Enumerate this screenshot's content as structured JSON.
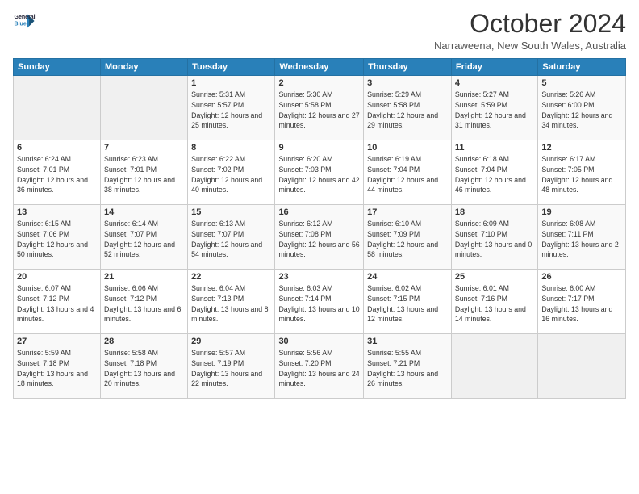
{
  "logo": {
    "line1": "General",
    "line2": "Blue"
  },
  "title": "October 2024",
  "location": "Narraweena, New South Wales, Australia",
  "days_header": [
    "Sunday",
    "Monday",
    "Tuesday",
    "Wednesday",
    "Thursday",
    "Friday",
    "Saturday"
  ],
  "weeks": [
    [
      {
        "day": "",
        "sunrise": "",
        "sunset": "",
        "daylight": ""
      },
      {
        "day": "",
        "sunrise": "",
        "sunset": "",
        "daylight": ""
      },
      {
        "day": "1",
        "sunrise": "Sunrise: 5:31 AM",
        "sunset": "Sunset: 5:57 PM",
        "daylight": "Daylight: 12 hours and 25 minutes."
      },
      {
        "day": "2",
        "sunrise": "Sunrise: 5:30 AM",
        "sunset": "Sunset: 5:58 PM",
        "daylight": "Daylight: 12 hours and 27 minutes."
      },
      {
        "day": "3",
        "sunrise": "Sunrise: 5:29 AM",
        "sunset": "Sunset: 5:58 PM",
        "daylight": "Daylight: 12 hours and 29 minutes."
      },
      {
        "day": "4",
        "sunrise": "Sunrise: 5:27 AM",
        "sunset": "Sunset: 5:59 PM",
        "daylight": "Daylight: 12 hours and 31 minutes."
      },
      {
        "day": "5",
        "sunrise": "Sunrise: 5:26 AM",
        "sunset": "Sunset: 6:00 PM",
        "daylight": "Daylight: 12 hours and 34 minutes."
      }
    ],
    [
      {
        "day": "6",
        "sunrise": "Sunrise: 6:24 AM",
        "sunset": "Sunset: 7:01 PM",
        "daylight": "Daylight: 12 hours and 36 minutes."
      },
      {
        "day": "7",
        "sunrise": "Sunrise: 6:23 AM",
        "sunset": "Sunset: 7:01 PM",
        "daylight": "Daylight: 12 hours and 38 minutes."
      },
      {
        "day": "8",
        "sunrise": "Sunrise: 6:22 AM",
        "sunset": "Sunset: 7:02 PM",
        "daylight": "Daylight: 12 hours and 40 minutes."
      },
      {
        "day": "9",
        "sunrise": "Sunrise: 6:20 AM",
        "sunset": "Sunset: 7:03 PM",
        "daylight": "Daylight: 12 hours and 42 minutes."
      },
      {
        "day": "10",
        "sunrise": "Sunrise: 6:19 AM",
        "sunset": "Sunset: 7:04 PM",
        "daylight": "Daylight: 12 hours and 44 minutes."
      },
      {
        "day": "11",
        "sunrise": "Sunrise: 6:18 AM",
        "sunset": "Sunset: 7:04 PM",
        "daylight": "Daylight: 12 hours and 46 minutes."
      },
      {
        "day": "12",
        "sunrise": "Sunrise: 6:17 AM",
        "sunset": "Sunset: 7:05 PM",
        "daylight": "Daylight: 12 hours and 48 minutes."
      }
    ],
    [
      {
        "day": "13",
        "sunrise": "Sunrise: 6:15 AM",
        "sunset": "Sunset: 7:06 PM",
        "daylight": "Daylight: 12 hours and 50 minutes."
      },
      {
        "day": "14",
        "sunrise": "Sunrise: 6:14 AM",
        "sunset": "Sunset: 7:07 PM",
        "daylight": "Daylight: 12 hours and 52 minutes."
      },
      {
        "day": "15",
        "sunrise": "Sunrise: 6:13 AM",
        "sunset": "Sunset: 7:07 PM",
        "daylight": "Daylight: 12 hours and 54 minutes."
      },
      {
        "day": "16",
        "sunrise": "Sunrise: 6:12 AM",
        "sunset": "Sunset: 7:08 PM",
        "daylight": "Daylight: 12 hours and 56 minutes."
      },
      {
        "day": "17",
        "sunrise": "Sunrise: 6:10 AM",
        "sunset": "Sunset: 7:09 PM",
        "daylight": "Daylight: 12 hours and 58 minutes."
      },
      {
        "day": "18",
        "sunrise": "Sunrise: 6:09 AM",
        "sunset": "Sunset: 7:10 PM",
        "daylight": "Daylight: 13 hours and 0 minutes."
      },
      {
        "day": "19",
        "sunrise": "Sunrise: 6:08 AM",
        "sunset": "Sunset: 7:11 PM",
        "daylight": "Daylight: 13 hours and 2 minutes."
      }
    ],
    [
      {
        "day": "20",
        "sunrise": "Sunrise: 6:07 AM",
        "sunset": "Sunset: 7:12 PM",
        "daylight": "Daylight: 13 hours and 4 minutes."
      },
      {
        "day": "21",
        "sunrise": "Sunrise: 6:06 AM",
        "sunset": "Sunset: 7:12 PM",
        "daylight": "Daylight: 13 hours and 6 minutes."
      },
      {
        "day": "22",
        "sunrise": "Sunrise: 6:04 AM",
        "sunset": "Sunset: 7:13 PM",
        "daylight": "Daylight: 13 hours and 8 minutes."
      },
      {
        "day": "23",
        "sunrise": "Sunrise: 6:03 AM",
        "sunset": "Sunset: 7:14 PM",
        "daylight": "Daylight: 13 hours and 10 minutes."
      },
      {
        "day": "24",
        "sunrise": "Sunrise: 6:02 AM",
        "sunset": "Sunset: 7:15 PM",
        "daylight": "Daylight: 13 hours and 12 minutes."
      },
      {
        "day": "25",
        "sunrise": "Sunrise: 6:01 AM",
        "sunset": "Sunset: 7:16 PM",
        "daylight": "Daylight: 13 hours and 14 minutes."
      },
      {
        "day": "26",
        "sunrise": "Sunrise: 6:00 AM",
        "sunset": "Sunset: 7:17 PM",
        "daylight": "Daylight: 13 hours and 16 minutes."
      }
    ],
    [
      {
        "day": "27",
        "sunrise": "Sunrise: 5:59 AM",
        "sunset": "Sunset: 7:18 PM",
        "daylight": "Daylight: 13 hours and 18 minutes."
      },
      {
        "day": "28",
        "sunrise": "Sunrise: 5:58 AM",
        "sunset": "Sunset: 7:18 PM",
        "daylight": "Daylight: 13 hours and 20 minutes."
      },
      {
        "day": "29",
        "sunrise": "Sunrise: 5:57 AM",
        "sunset": "Sunset: 7:19 PM",
        "daylight": "Daylight: 13 hours and 22 minutes."
      },
      {
        "day": "30",
        "sunrise": "Sunrise: 5:56 AM",
        "sunset": "Sunset: 7:20 PM",
        "daylight": "Daylight: 13 hours and 24 minutes."
      },
      {
        "day": "31",
        "sunrise": "Sunrise: 5:55 AM",
        "sunset": "Sunset: 7:21 PM",
        "daylight": "Daylight: 13 hours and 26 minutes."
      },
      {
        "day": "",
        "sunrise": "",
        "sunset": "",
        "daylight": ""
      },
      {
        "day": "",
        "sunrise": "",
        "sunset": "",
        "daylight": ""
      }
    ]
  ]
}
